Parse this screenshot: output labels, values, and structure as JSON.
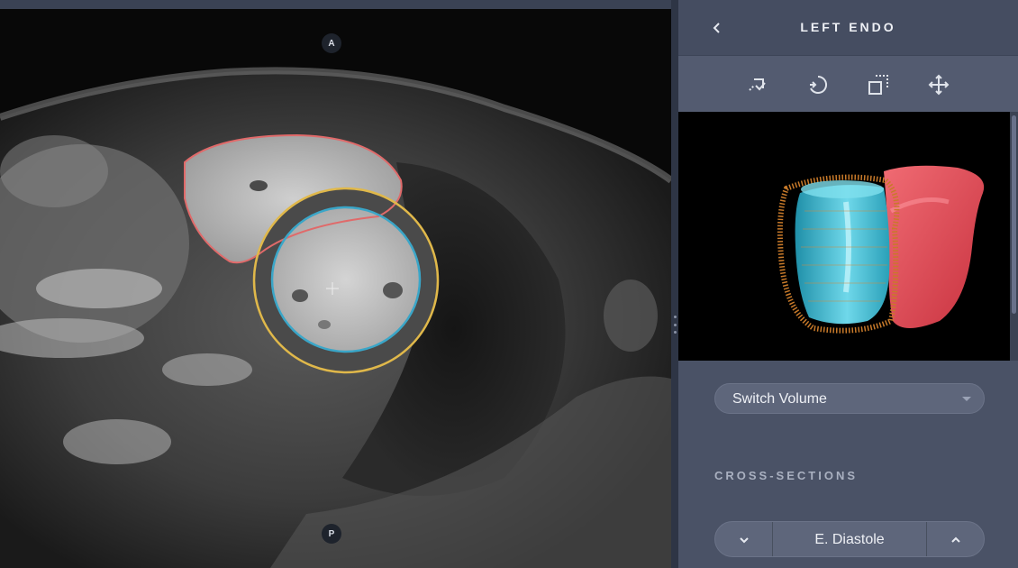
{
  "viewer": {
    "orientation_top": "A",
    "orientation_bottom": "P"
  },
  "panel": {
    "back_icon": "chevron-left-icon",
    "title": "LEFT ENDO",
    "tools": [
      {
        "name": "draw-contour-icon"
      },
      {
        "name": "rotate-icon"
      },
      {
        "name": "crop-icon"
      },
      {
        "name": "move-icon"
      }
    ],
    "volume_select": {
      "label": "Switch Volume"
    },
    "cross_sections": {
      "title": "CROSS-SECTIONS",
      "prev_icon": "chevron-down-icon",
      "next_icon": "chevron-up-icon",
      "current": "E. Diastole"
    }
  },
  "colors": {
    "panel_bg": "#4a5266",
    "rv_contour": "#e06a6a",
    "endo_contour": "#3aa6c8",
    "epi_contour": "#e0b84a",
    "rv_model": "#e04a55",
    "lv_model": "#2fb0c8"
  }
}
